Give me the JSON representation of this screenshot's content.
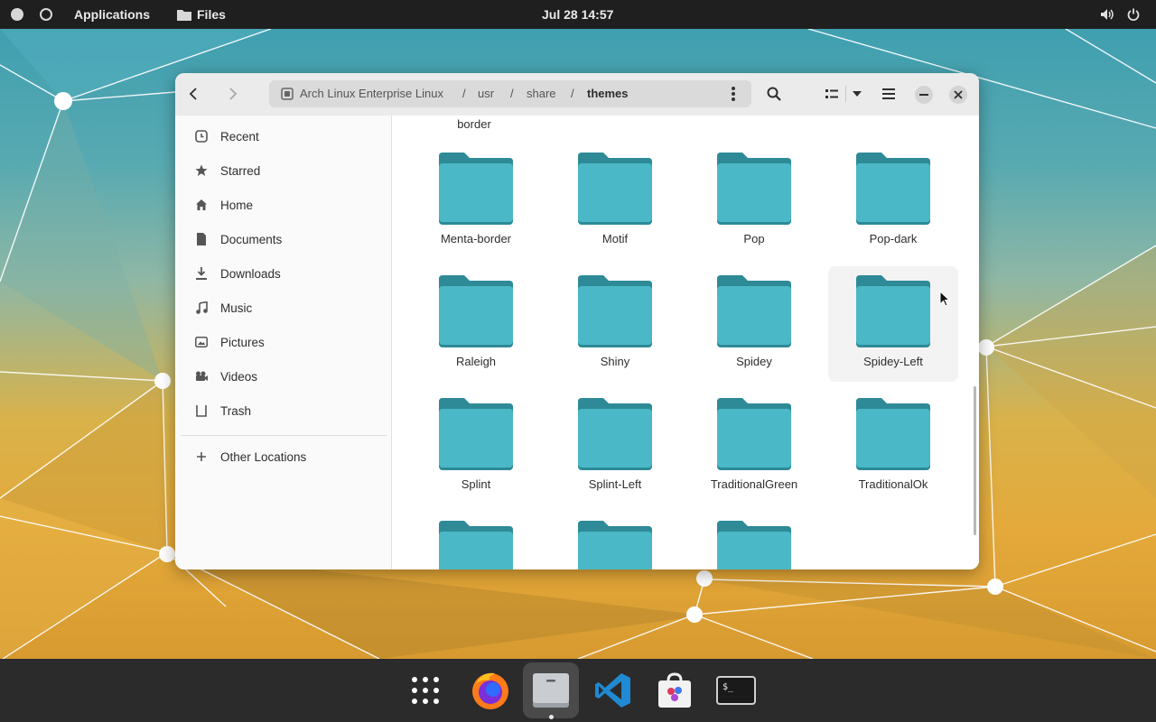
{
  "colors": {
    "folder": "#4ab8c6",
    "folder_tab": "#2e8a97",
    "topbar": "#1f1f1f",
    "dock": "#2b2b2b"
  },
  "topbar": {
    "applications": "Applications",
    "files_label": "Files",
    "clock": "Jul 28  14:57",
    "icons": [
      "activities-dot-icon",
      "workspace-ring-icon",
      "folder-icon",
      "volume-icon",
      "power-icon"
    ]
  },
  "window": {
    "path": [
      "Arch Linux Enterprise Linux",
      "/",
      "usr",
      "/",
      "share",
      "/",
      "themes"
    ],
    "sidebar": {
      "items": [
        {
          "label": "Recent",
          "icon": "clock-icon"
        },
        {
          "label": "Starred",
          "icon": "star-icon"
        },
        {
          "label": "Home",
          "icon": "home-icon"
        },
        {
          "label": "Documents",
          "icon": "document-icon"
        },
        {
          "label": "Downloads",
          "icon": "download-icon"
        },
        {
          "label": "Music",
          "icon": "music-icon"
        },
        {
          "label": "Pictures",
          "icon": "picture-icon"
        },
        {
          "label": "Videos",
          "icon": "video-icon"
        },
        {
          "label": "Trash",
          "icon": "trash-icon"
        }
      ],
      "other_locations": "Other Locations"
    },
    "partial_top_label": "border",
    "folders": [
      [
        "Menta-border",
        "Motif",
        "Pop",
        "Pop-dark"
      ],
      [
        "Raleigh",
        "Shiny",
        "Spidey",
        "Spidey-Left"
      ],
      [
        "Splint",
        "Splint-Left",
        "TraditionalGreen",
        "TraditionalOk"
      ],
      [
        "",
        "",
        ""
      ]
    ]
  },
  "dock": {
    "items": [
      "app-grid-icon",
      "firefox-icon",
      "files-icon",
      "vscode-icon",
      "software-store-icon",
      "terminal-icon"
    ]
  }
}
